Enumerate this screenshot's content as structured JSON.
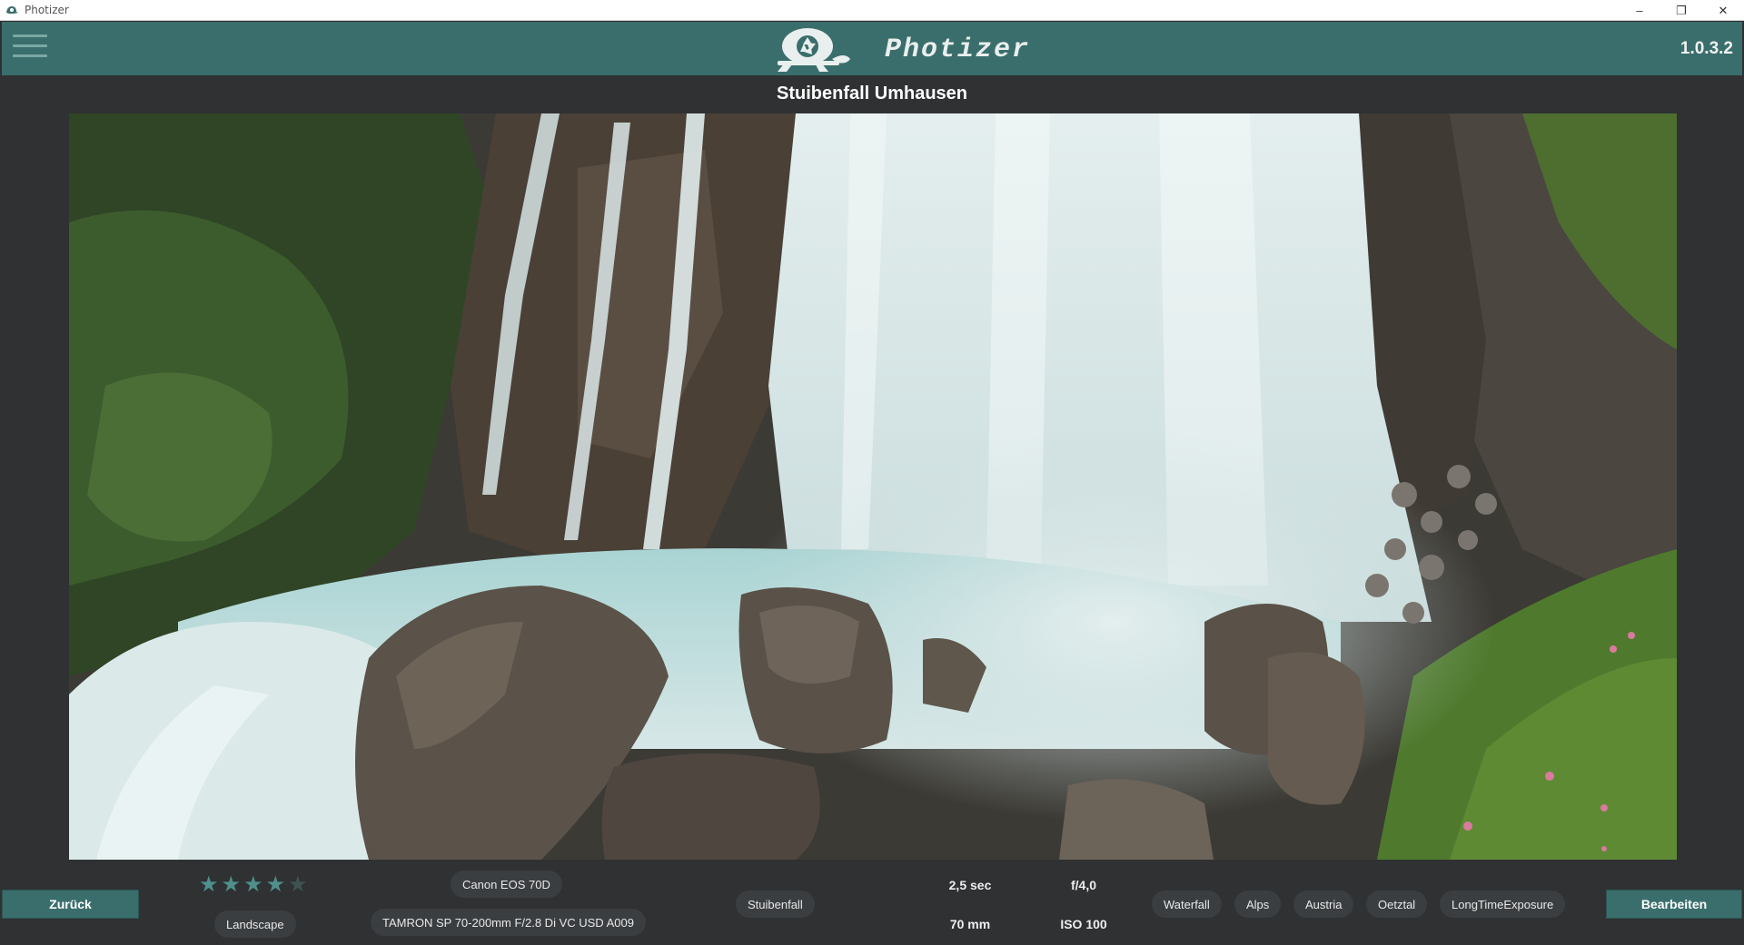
{
  "window": {
    "title": "Photizer",
    "minimize_glyph": "–",
    "restore_glyph": "❐",
    "close_glyph": "✕"
  },
  "header": {
    "app_name": "Photizer",
    "version": "1.0.3.2",
    "menu_icon": "hamburger-icon",
    "logo_icon": "turtle-aperture-logo",
    "accent": "#3a6e6c"
  },
  "photo": {
    "title": "Stuibenfall Umhausen"
  },
  "rating": {
    "stars": 4,
    "max": 5,
    "glyph": "★"
  },
  "footer": {
    "back_label": "Zurück",
    "edit_label": "Bearbeiten",
    "category": "Landscape",
    "camera": "Canon EOS 70D",
    "lens": "TAMRON SP 70-200mm F/2.8 Di VC USD A009",
    "location": "Stuibenfall",
    "exposure": "2,5 sec",
    "aperture": "f/4,0",
    "focal_length": "70 mm",
    "iso": "ISO 100",
    "tags": [
      "Waterfall",
      "Alps",
      "Austria",
      "Oetztal",
      "LongTimeExposure"
    ]
  }
}
